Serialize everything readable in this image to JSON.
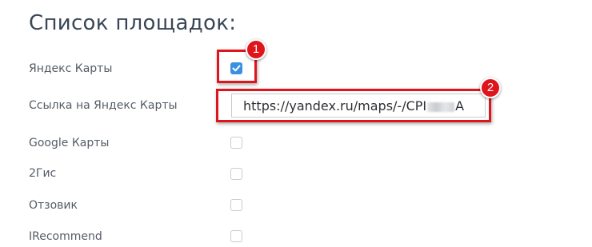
{
  "page": {
    "title": "Список площадок:"
  },
  "platforms": [
    {
      "label": "Яндекс Карты",
      "checked": true
    },
    {
      "label": "Ссылка на Яндекс Карты",
      "value_start": "https://yandex.ru/maps/-/CPI",
      "value_end": "A"
    },
    {
      "label": "Google Карты",
      "checked": false
    },
    {
      "label": "2Гис",
      "checked": false
    },
    {
      "label": "Отзовик",
      "checked": false
    },
    {
      "label": "IRecommend",
      "checked": false
    }
  ],
  "annotations": [
    {
      "number": "1"
    },
    {
      "number": "2"
    }
  ],
  "colors": {
    "accent": "#3b8fe0",
    "highlight": "#e0141b"
  }
}
